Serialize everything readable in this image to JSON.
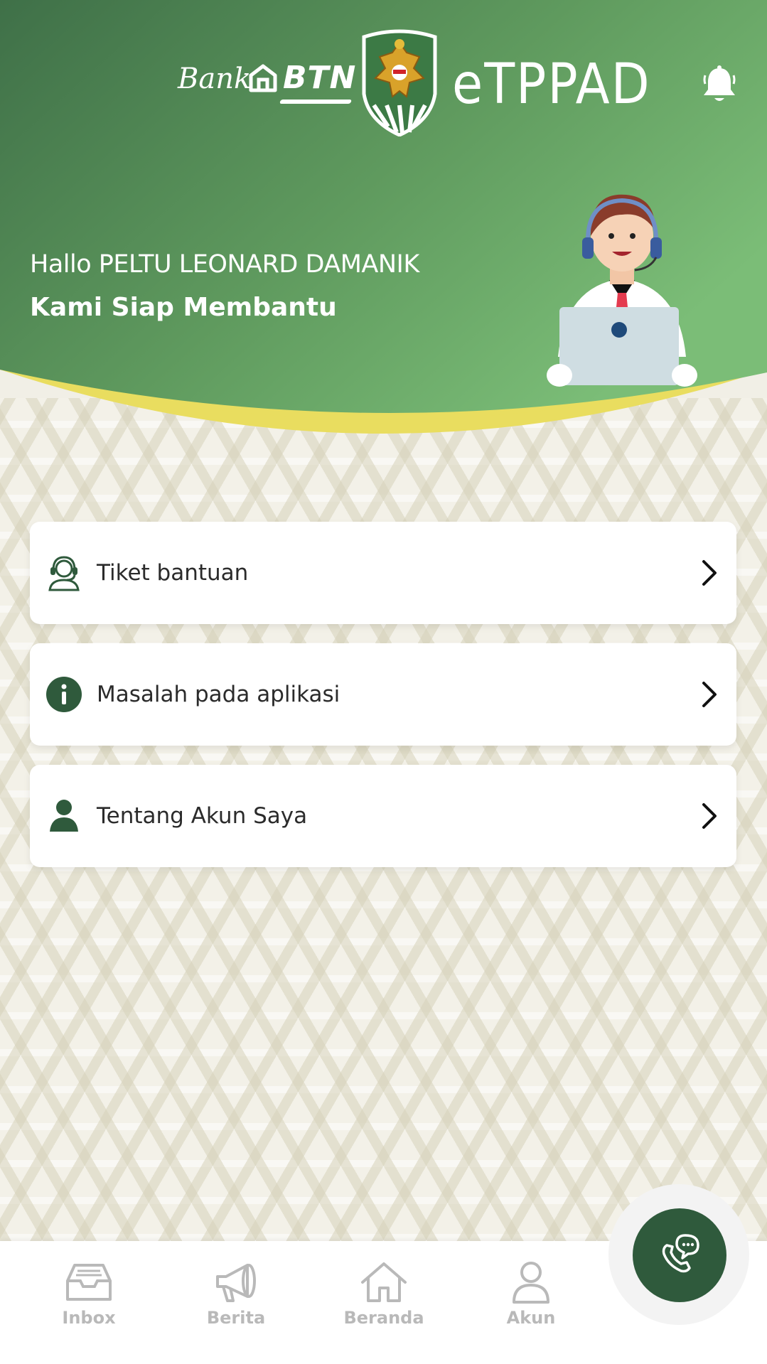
{
  "header": {
    "bank_word": "Bank",
    "brand": "BTN",
    "app_name": "eTPPAD",
    "greeting": "Hallo PELTU LEONARD DAMANIK",
    "subgreeting": "Kami Siap Membantu"
  },
  "menu": [
    {
      "label": "Tiket bantuan",
      "icon": "headset-user-icon"
    },
    {
      "label": "Masalah pada aplikasi",
      "icon": "info-icon"
    },
    {
      "label": "Tentang Akun Saya",
      "icon": "user-icon"
    }
  ],
  "nav": [
    {
      "label": "Inbox",
      "icon": "inbox-icon"
    },
    {
      "label": "Berita",
      "icon": "megaphone-icon"
    },
    {
      "label": "Beranda",
      "icon": "home-icon"
    },
    {
      "label": "Akun",
      "icon": "person-icon"
    }
  ],
  "fab": {
    "icon": "phone-chat-icon"
  },
  "colors": {
    "header_dark": "#3f7048",
    "header_light": "#79b874",
    "wave_yellow": "#e9dd5f",
    "primary": "#2f5a3c",
    "nav_inactive": "#b9b9b9"
  }
}
